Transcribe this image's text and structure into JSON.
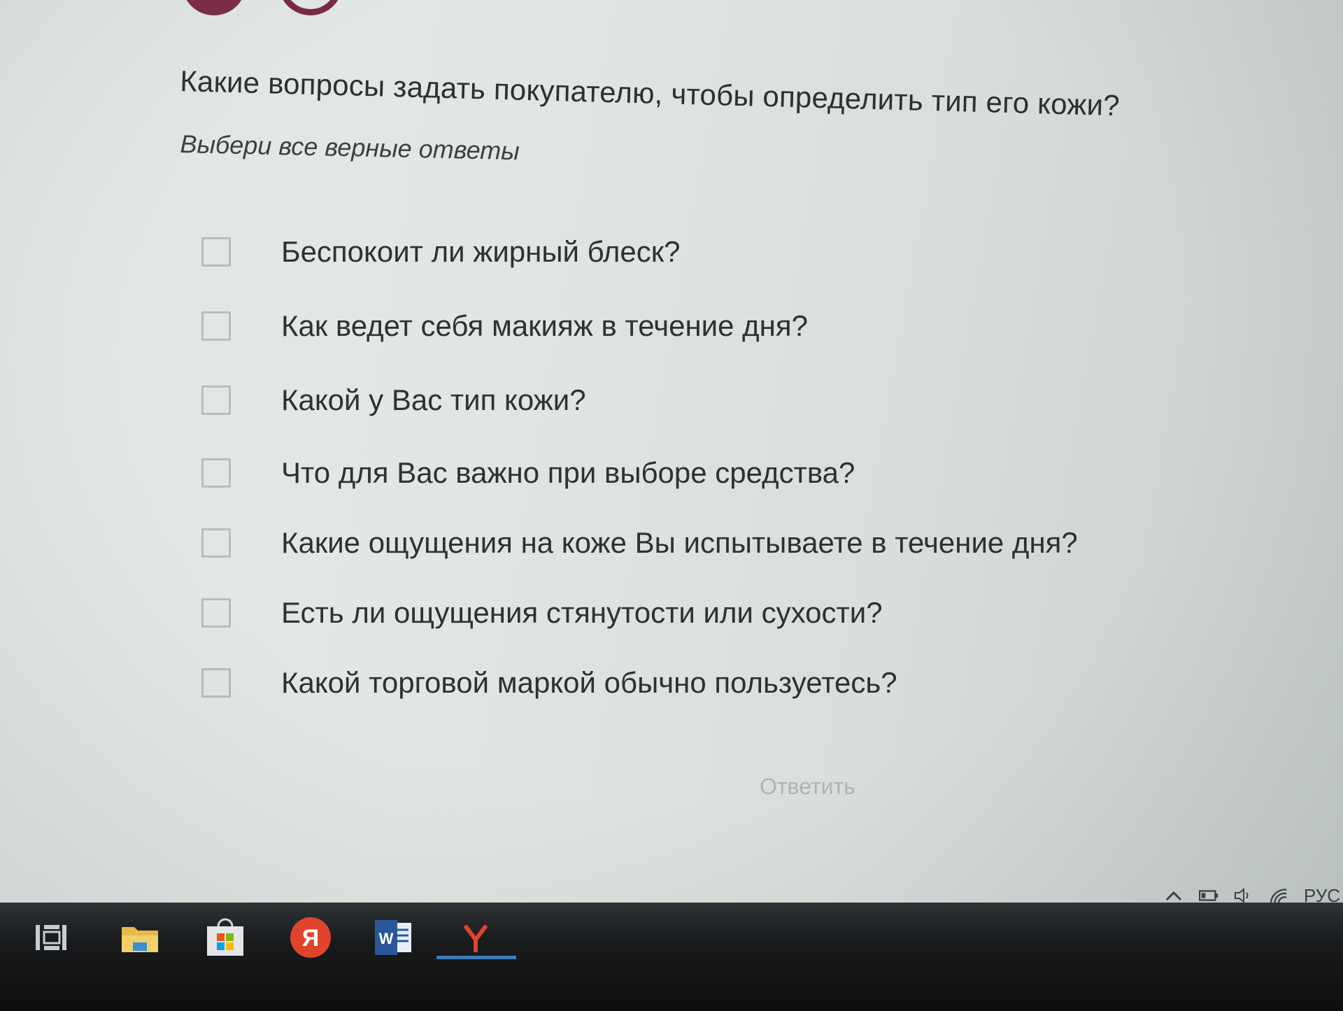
{
  "quiz": {
    "question": "Какие вопросы задать покупателю, чтобы определить тип его кожи?",
    "hint": "Выбери все верные ответы",
    "options": [
      {
        "label": "Беспокоит ли жирный блеск?",
        "checked": false
      },
      {
        "label": "Как ведет себя макияж в течение дня?",
        "checked": false
      },
      {
        "label": "Какой у Вас тип кожи?",
        "checked": false
      },
      {
        "label": "Что для Вас важно при выборе средства?",
        "checked": false
      },
      {
        "label": "Какие ощущения на коже Вы испытываете в течение дня?",
        "checked": false
      },
      {
        "label": "Есть ли ощущения стянутости или сухости?",
        "checked": false
      },
      {
        "label": "Какой торговой маркой обычно пользуетесь?",
        "checked": false
      }
    ],
    "submit_label": "Ответить",
    "progress": {
      "completed": 1,
      "current": 2
    }
  },
  "tray": {
    "icons": [
      "chevron-up-icon",
      "battery-icon",
      "volume-icon",
      "wifi-icon"
    ],
    "language": "РУС"
  },
  "taskbar": {
    "icons": [
      "task-view-icon",
      "file-explorer-icon",
      "store-icon",
      "yandex-browser-icon",
      "word-icon",
      "yandex-icon"
    ],
    "active": "yandex-icon"
  },
  "colors": {
    "accent": "#7a2846",
    "submit_disabled": "#a9b6b6",
    "checkbox_border": "#b8bcbb",
    "taskbar": "#121314",
    "taskbar_active": "#3a7bbf",
    "yandex_red": "#e0452b"
  }
}
